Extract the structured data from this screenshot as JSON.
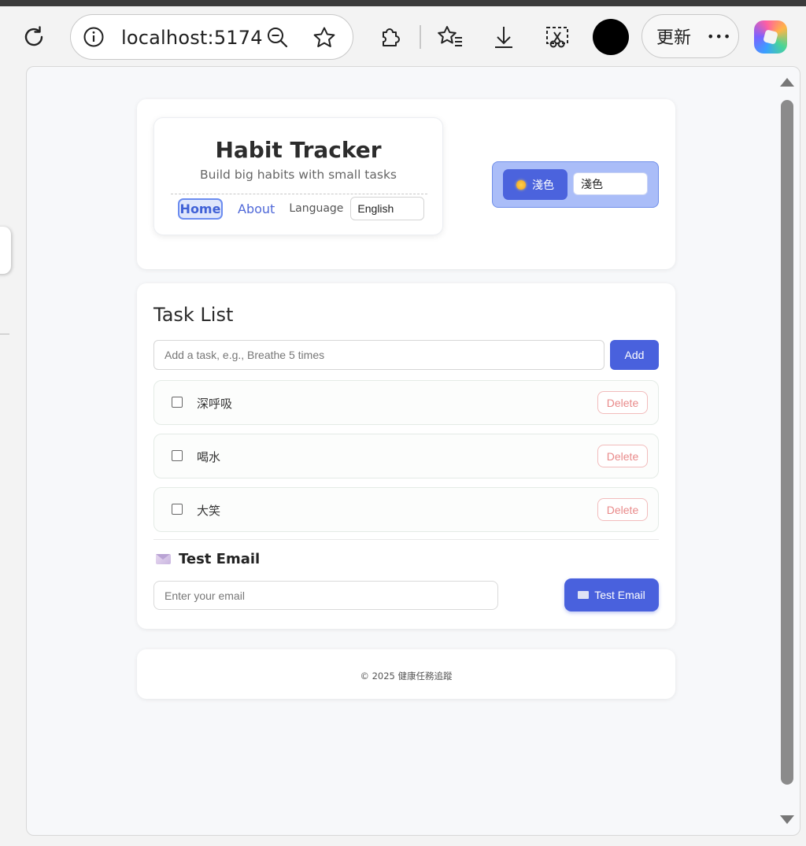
{
  "browser": {
    "url": "localhost:5174",
    "update_label": "更新",
    "more_label": "•••"
  },
  "header": {
    "title": "Habit Tracker",
    "subtitle": "Build big habits with small tasks",
    "nav": {
      "home": "Home",
      "about": "About",
      "language_label": "Language",
      "language_value": "English"
    },
    "theme": {
      "button_label": "淺色",
      "select_value": "淺色"
    }
  },
  "tasks": {
    "title": "Task List",
    "input_placeholder": "Add a task, e.g., Breathe 5 times",
    "add_label": "Add",
    "items": [
      {
        "text": "深呼吸",
        "delete_label": "Delete",
        "checked": false
      },
      {
        "text": "喝水",
        "delete_label": "Delete",
        "checked": false
      },
      {
        "text": "大笑",
        "delete_label": "Delete",
        "checked": false
      }
    ]
  },
  "email": {
    "title": "Test Email",
    "input_placeholder": "Enter your email",
    "button_label": "Test Email"
  },
  "footer": {
    "text": "© 2025 健康任務追蹤"
  },
  "colors": {
    "accent": "#4961dd",
    "theme_panel": "#aabdf8",
    "delete": "#e98a8a"
  }
}
